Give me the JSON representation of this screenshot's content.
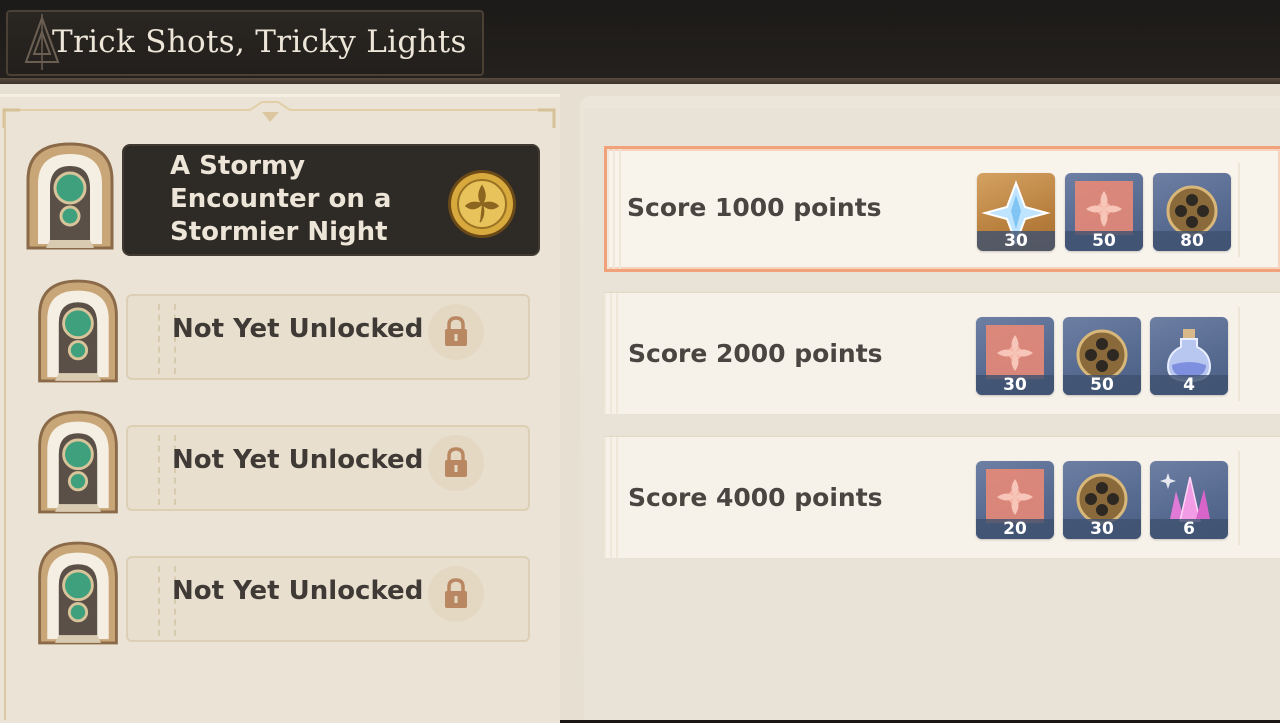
{
  "event": {
    "title": "Trick Shots, Tricky Lights"
  },
  "stages": [
    {
      "label": "A Stormy Encounter on a Stormier Night",
      "state": "active",
      "icon": "gold-medal-icon"
    },
    {
      "label": "Not Yet Unlocked",
      "state": "locked",
      "icon": "lock-icon"
    },
    {
      "label": "Not Yet Unlocked",
      "state": "locked",
      "icon": "lock-icon"
    },
    {
      "label": "Not Yet Unlocked",
      "state": "locked",
      "icon": "lock-icon"
    }
  ],
  "rewards": [
    {
      "label": "Score 1000 points",
      "highlighted": true,
      "items": [
        {
          "name": "primogem-icon",
          "qty": "30",
          "rarity": "gold"
        },
        {
          "name": "flower-material-icon",
          "qty": "50",
          "rarity": "blue"
        },
        {
          "name": "film-reel-icon",
          "qty": "80",
          "rarity": "blue"
        }
      ]
    },
    {
      "label": "Score 2000 points",
      "highlighted": false,
      "items": [
        {
          "name": "flower-material-icon",
          "qty": "30",
          "rarity": "blue"
        },
        {
          "name": "film-reel-icon",
          "qty": "50",
          "rarity": "blue"
        },
        {
          "name": "potion-bottle-icon",
          "qty": "4",
          "rarity": "blue"
        }
      ]
    },
    {
      "label": "Score 4000 points",
      "highlighted": false,
      "items": [
        {
          "name": "flower-material-icon",
          "qty": "20",
          "rarity": "blue"
        },
        {
          "name": "film-reel-icon",
          "qty": "30",
          "rarity": "blue"
        },
        {
          "name": "crystal-ore-icon",
          "qty": "6",
          "rarity": "blue"
        }
      ]
    }
  ],
  "colors": {
    "active_card": "#2e2a26",
    "highlight_border": "#f2a27a",
    "blue_rarity": "#56698f",
    "gold_rarity": "#b9803e"
  }
}
